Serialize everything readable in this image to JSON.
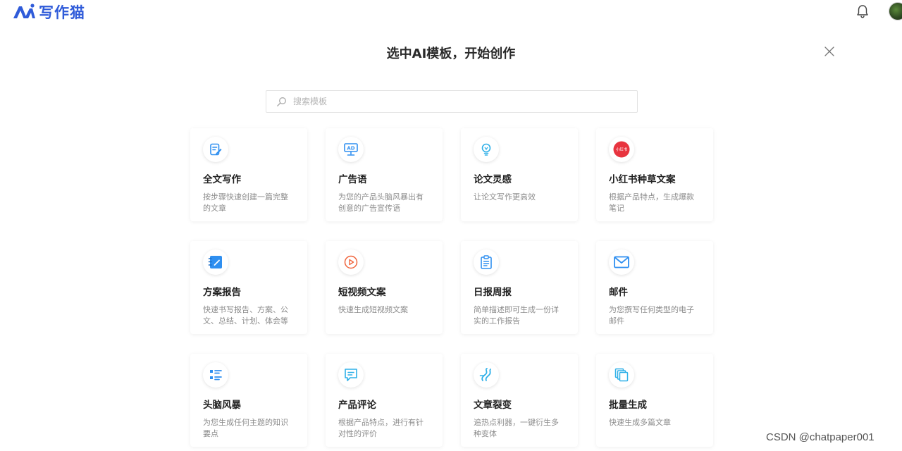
{
  "header": {
    "logo_text": "写作猫"
  },
  "modal": {
    "title": "选中AI模板，开始创作"
  },
  "search": {
    "placeholder": "搜索模板"
  },
  "templates": [
    {
      "title": "全文写作",
      "desc": "按步骤快速创建一篇完整的文章",
      "icon": "edit-doc-icon"
    },
    {
      "title": "广告语",
      "desc": "为您的产品头脑风暴出有创意的广告宣传语",
      "icon": "ad-board-icon"
    },
    {
      "title": "论文灵感",
      "desc": "让论文写作更高效",
      "icon": "lightbulb-icon"
    },
    {
      "title": "小红书种草文案",
      "desc": "根据产品特点，生成爆款笔记",
      "icon": "xiaohongshu-icon",
      "icon_text": "小红书"
    },
    {
      "title": "方案报告",
      "desc": "快速书写报告、方案、公文、总结、计划、体会等",
      "icon": "notebook-icon"
    },
    {
      "title": "短视频文案",
      "desc": "快速生成短视频文案",
      "icon": "play-circle-icon"
    },
    {
      "title": "日报周报",
      "desc": "简单描述即可生成一份详实的工作报告",
      "icon": "clipboard-icon"
    },
    {
      "title": "邮件",
      "desc": "为您撰写任何类型的电子邮件",
      "icon": "mail-icon"
    },
    {
      "title": "头脑风暴",
      "desc": "为您生成任何主题的知识要点",
      "icon": "list-icon"
    },
    {
      "title": "产品评论",
      "desc": "根据产品特点，进行有针对性的评价",
      "icon": "comment-icon"
    },
    {
      "title": "文章裂变",
      "desc": "追热点利器，一键衍生多种变体",
      "icon": "split-icon"
    },
    {
      "title": "批量生成",
      "desc": "快速生成多篇文章",
      "icon": "copies-icon"
    }
  ],
  "watermark": "CSDN @chatpaper001",
  "colors": {
    "brand": "#2f5bd9",
    "icon_blue": "#2f8ff0",
    "xiaohongshu_red": "#e8343f",
    "video_red": "#f0643c"
  }
}
